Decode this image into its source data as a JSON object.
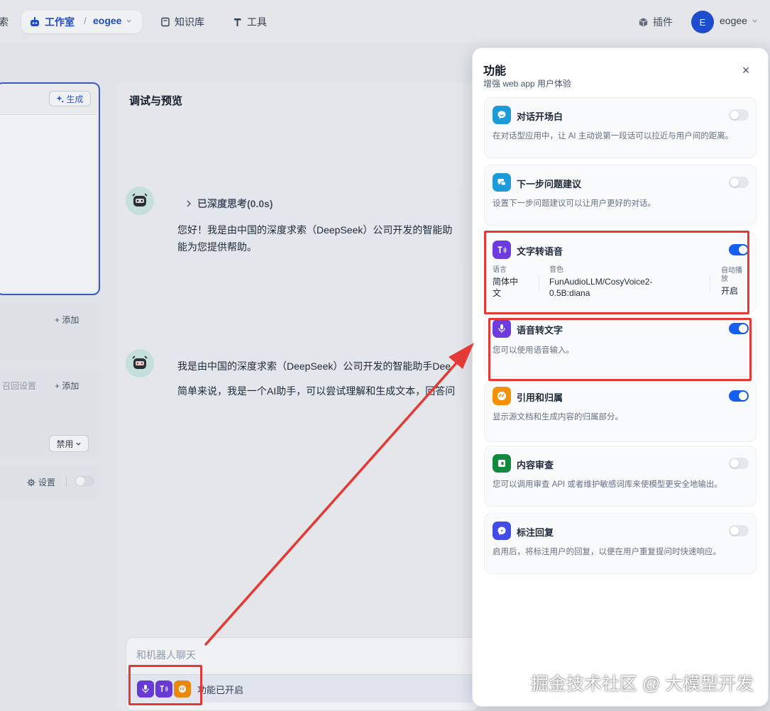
{
  "nav": {
    "cut_label": "索",
    "studio": "工作室",
    "separator": "/",
    "workspace": "eogee",
    "knowledge": "知识库",
    "tools": "工具",
    "plugins": "插件",
    "avatar_letter": "E",
    "user": "eogee"
  },
  "left": {
    "generate": "生成",
    "add_1": "添加",
    "recall_settings": "召回设置",
    "add_2": "添加",
    "disable": "禁用",
    "settings": "设置"
  },
  "preview": {
    "title": "调试与预览",
    "think_label": "已深度思考(0.0s)",
    "msg1_line1": "您好！我是由中国的深度求索（DeepSeek）公司开发的智能助",
    "msg1_line2": "能为您提供帮助。",
    "msg2_line1": "我是由中国的深度求索（DeepSeek）公司开发的智能助手Dee",
    "msg2_line2": "简单来说，我是一个AI助手，可以尝试理解和生成文本，回答问",
    "input_placeholder": "和机器人聊天",
    "features_enabled": "功能已开启"
  },
  "drawer": {
    "title": "功能",
    "subtitle": "增强 web app 用户体验",
    "close": "×",
    "features": [
      {
        "title": "对话开场白",
        "desc": "在对话型应用中，让 AI 主动说第一段话可以拉近与用户间的距离。",
        "enabled": false,
        "color": "#1d9bd8",
        "icon": "chat-bubble-icon"
      },
      {
        "title": "下一步问题建议",
        "desc": "设置下一步问题建议可以让用户更好的对话。",
        "enabled": false,
        "color": "#1d9bd8",
        "icon": "suggest-icon"
      },
      {
        "title": "文字转语音",
        "enabled": true,
        "color": "#6d3be0",
        "icon": "text-to-speech-icon"
      },
      {
        "title": "语音转文字",
        "desc": "您可以使用语音输入。",
        "enabled": true,
        "color": "#6d3be0",
        "icon": "microphone-icon"
      },
      {
        "title": "引用和归属",
        "desc": "显示源文档和生成内容的归属部分。",
        "enabled": true,
        "color": "#f79009",
        "icon": "quote-icon"
      },
      {
        "title": "内容审查",
        "desc": "您可以调用审查 API 或者维护敏感词库来使模型更安全地输出。",
        "enabled": false,
        "color": "#12893f",
        "icon": "moderation-icon"
      },
      {
        "title": "标注回复",
        "desc": "启用后，将标注用户的回复，以便在用户重复提问时快速响应。",
        "enabled": false,
        "color": "#444ce7",
        "icon": "annotation-icon"
      }
    ],
    "tts": {
      "lang_label": "语言",
      "lang_value_1": "简体中",
      "lang_value_2": "文",
      "voice_label": "音色",
      "voice_value_1": "FunAudioLLM/CosyVoice2-",
      "voice_value_2": "0.5B:diana",
      "auto_label_1": "自动播",
      "auto_label_2": "放",
      "auto_value": "开启"
    }
  },
  "watermark": "掘金技术社区 @ 大模型开发"
}
